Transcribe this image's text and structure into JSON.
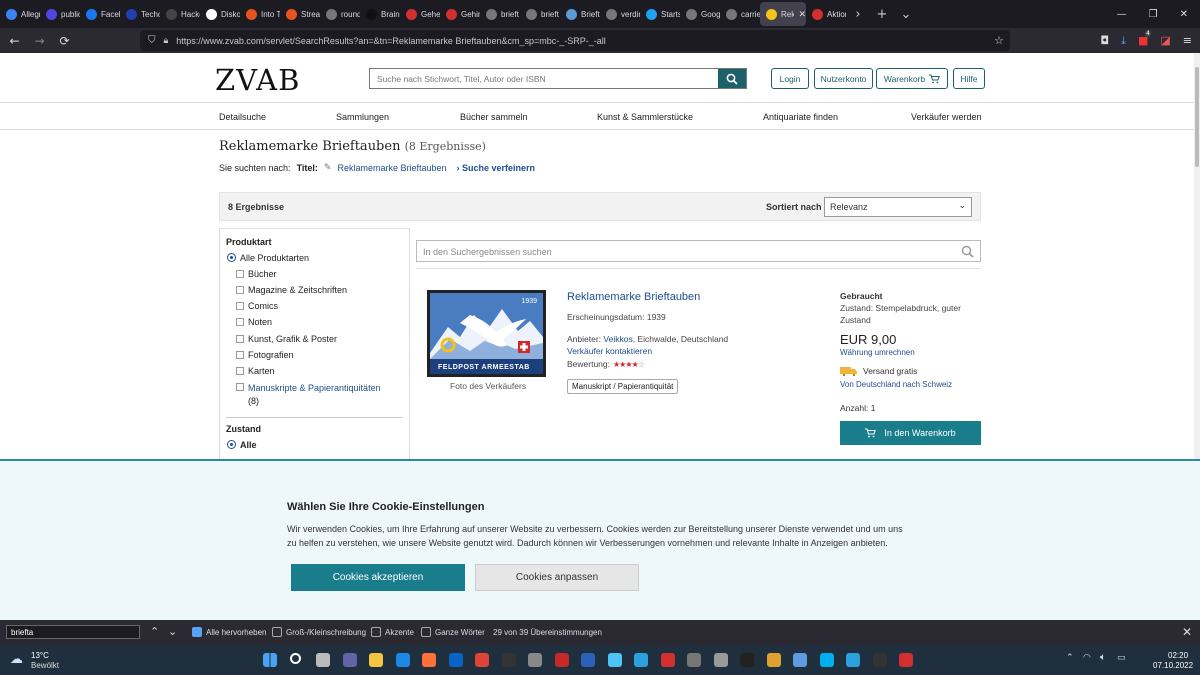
{
  "browser": {
    "tabs": [
      {
        "title": "Allegr",
        "color": "#3b82f6"
      },
      {
        "title": "public",
        "color": "#4f46e5"
      },
      {
        "title": "Facebo",
        "color": "#1877f2"
      },
      {
        "title": "Techo",
        "color": "#1e40af"
      },
      {
        "title": "Hacke",
        "color": "#444444"
      },
      {
        "title": "Disko",
        "color": "#ffffff"
      },
      {
        "title": "Into T WIEDER",
        "color": "#e8541e"
      },
      {
        "title": "Stream",
        "color": "#e8541e"
      },
      {
        "title": "round",
        "color": "#777777"
      },
      {
        "title": "Brain",
        "color": "#111111"
      },
      {
        "title": "Gehei",
        "color": "#d32f2f"
      },
      {
        "title": "Gehir",
        "color": "#d32f2f"
      },
      {
        "title": "brieft",
        "color": "#777777"
      },
      {
        "title": "brieft",
        "color": "#777777"
      },
      {
        "title": "Brieft",
        "color": "#5a9bd5"
      },
      {
        "title": "verdir",
        "color": "#777777"
      },
      {
        "title": "Startse",
        "color": "#1da1f2"
      },
      {
        "title": "Goog",
        "color": "#777777"
      },
      {
        "title": "carrie",
        "color": "#777777"
      },
      {
        "title": "Rek",
        "color": "#f5c518",
        "active": true
      },
      {
        "title": "Aktion",
        "color": "#d32f2f"
      }
    ],
    "new_tab": "+",
    "url": "https://www.zvab.com/servlet/SearchResults?an=&tn=Reklamemarke Brieftauben&cm_sp=mbc-_-SRP-_-all",
    "downloads_badge": "4"
  },
  "site": {
    "logo": "ZVAB",
    "search_placeholder": "Suche nach Stichwort, Titel, Autor oder ISBN",
    "header_buttons": {
      "login": "Login",
      "account": "Nutzerkonto",
      "cart": "Warenkorb",
      "help": "Hilfe"
    },
    "nav": [
      "Detailsuche",
      "Sammlungen",
      "Bücher sammeln",
      "Kunst & Sammlerstücke",
      "Antiquariate finden",
      "Verkäufer werden"
    ]
  },
  "results": {
    "title": "Reklamemarke Brieftauben",
    "count_text": "(8 Ergebnisse)",
    "searched_for_label": "Sie suchten nach:",
    "title_label": "Titel:",
    "title_value": "Reklamemarke Brieftauben",
    "refine": "› Suche verfeinern",
    "count_bar": "8 Ergebnisse",
    "sort_label": "Sortiert nach",
    "sort_value": "Relevanz",
    "within_search_placeholder": "In den Suchergebnissen suchen"
  },
  "filters": {
    "product_heading": "Produktart",
    "all_types": "Alle Produktarten",
    "types": [
      "Bücher",
      "Magazine & Zeitschriften",
      "Comics",
      "Noten",
      "Kunst, Grafik & Poster",
      "Fotografien",
      "Karten"
    ],
    "manuscripts": "Manuskripte & Papierantiquitäten",
    "manuscripts_count": "(8)",
    "condition_heading": "Zustand",
    "condition_all": "Alle"
  },
  "listing": {
    "title": "Reklamemarke Brieftauben",
    "pub_date": "Erscheinungsdatum: 1939",
    "seller_label": "Anbieter:",
    "seller_name": "Veikkos",
    "seller_location": ", Eichwalde, Deutschland",
    "contact_seller": "Verkäufer kontaktieren",
    "rating_label": "Bewertung:",
    "rating": 4,
    "rating_max": 5,
    "category_tag": "Manuskript / Papierantiquität",
    "photo_caption": "Foto des Verkäufers",
    "stamp_year": "1939",
    "stamp_text": "FELDPOST ARMEESTAB",
    "condition_title": "Gebraucht",
    "condition_text": "Zustand: Stempelabdruck, guter Zustand",
    "price": "EUR 9,00",
    "convert_currency": "Währung umrechnen",
    "shipping_free": "Versand gratis",
    "shipping_route": "Von Deutschland nach Schweiz",
    "quantity": "Anzahl: 1",
    "add_to_cart": "In den Warenkorb"
  },
  "cookie": {
    "title": "Wählen Sie Ihre Cookie-Einstellungen",
    "text": "Wir verwenden Cookies, um Ihre Erfahrung auf unserer Website zu verbessern. Cookies werden zur Bereitstellung unserer Dienste verwendet und um uns zu helfen zu verstehen, wie unsere Website genutzt wird. Dadurch können wir Verbesserungen vornehmen und relevante Inhalte in Anzeigen anbieten.",
    "accept": "Cookies akzeptieren",
    "adjust": "Cookies anpassen"
  },
  "findbar": {
    "query": "briefta",
    "highlight_all": "Alle hervorheben",
    "match_case": "Groß-/Kleinschreibung",
    "accents": "Akzente",
    "whole_words": "Ganze Wörter",
    "status": "29 von 39 Übereinstimmungen"
  },
  "taskbar": {
    "weather_temp": "13°C",
    "weather_text": "Bewölkt",
    "time": "02:20",
    "date": "07.10.2022"
  }
}
